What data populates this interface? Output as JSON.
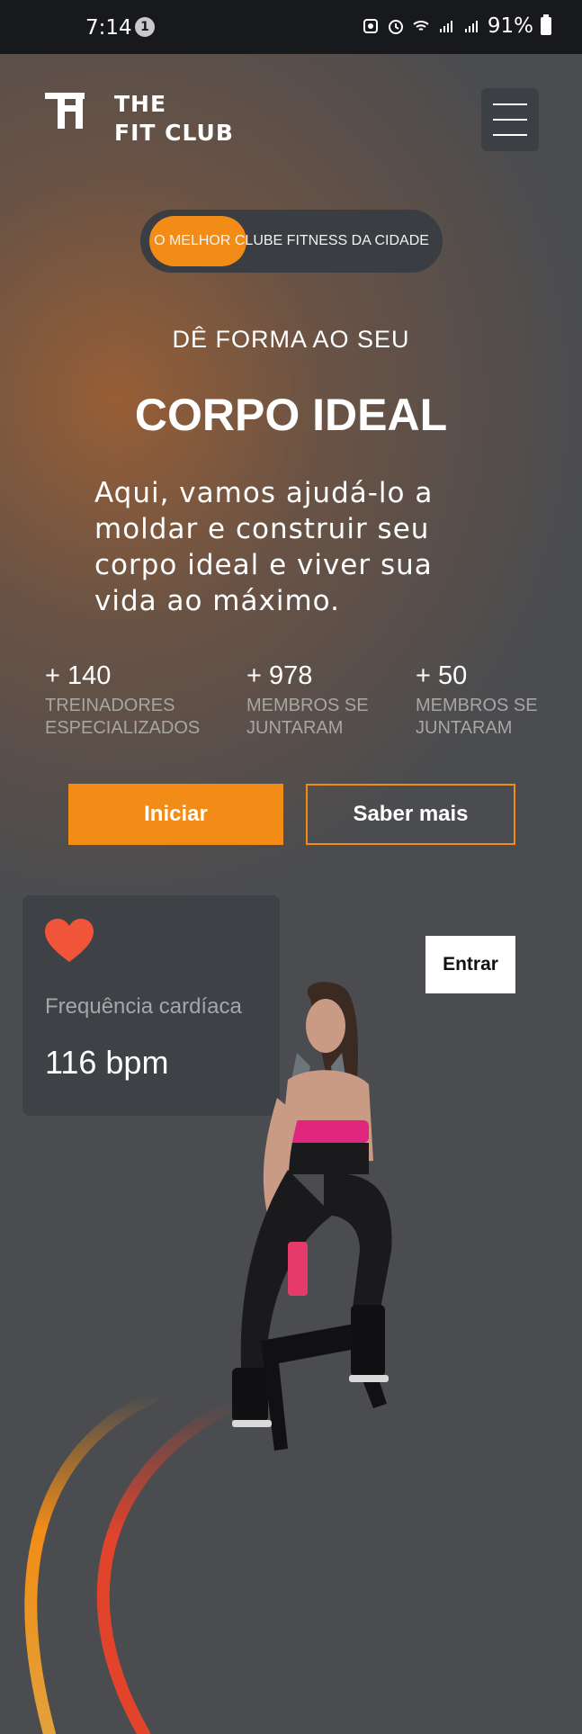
{
  "status_bar": {
    "time": "7:14",
    "notification_count": "1",
    "battery": "91%"
  },
  "header": {
    "logo_line1": "THE",
    "logo_line2": "FIT CLUB",
    "menu_icon": "hamburger-menu-icon"
  },
  "hero": {
    "tagline": "O MELHOR CLUBE FITNESS DA CIDADE",
    "pre_title": "DÊ FORMA AO SEU",
    "title": "CORPO IDEAL",
    "description": "Aqui, vamos ajudá-lo a moldar e construir seu corpo ideal e viver sua vida ao máximo."
  },
  "stats": [
    {
      "number": "+ 140",
      "label_line1": "TREINADORES",
      "label_line2": "ESPECIALIZADOS"
    },
    {
      "number": "+ 978",
      "label_line1": "MEMBROS SE",
      "label_line2": "JUNTARAM"
    },
    {
      "number": "+ 50",
      "label_line1": "MEMBROS SE",
      "label_line2": "JUNTARAM"
    }
  ],
  "buttons": {
    "start": "Iniciar",
    "learn_more": "Saber mais",
    "enter": "Entrar"
  },
  "heart_rate": {
    "icon": "heart-icon",
    "label": "Frequência cardíaca",
    "value": "116 bpm"
  },
  "colors": {
    "accent": "#f28c16",
    "background": "#4b4c4f",
    "card": "#3e4247",
    "heart": "#f0553a"
  }
}
